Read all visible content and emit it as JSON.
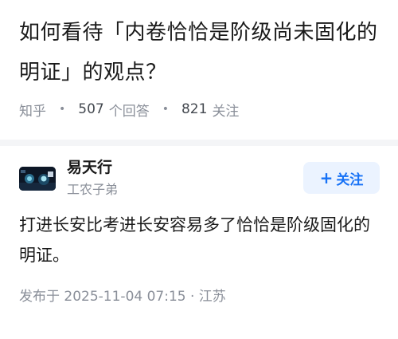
{
  "question": {
    "title": "如何看待「内卷恰恰是阶级尚未固化的明证」的观点？",
    "source": "知乎",
    "answer_count": "507",
    "answer_label": "个回答",
    "follow_count": "821",
    "follow_label": "关注"
  },
  "answer": {
    "author_name": "易天行",
    "author_bio": "工农子弟",
    "follow_button_label": "关注",
    "content": "打进长安比考进长安容易多了恰恰是阶级固化的明证。",
    "publish_info": "发布于  2025-11-04  07:15 · 江苏"
  }
}
